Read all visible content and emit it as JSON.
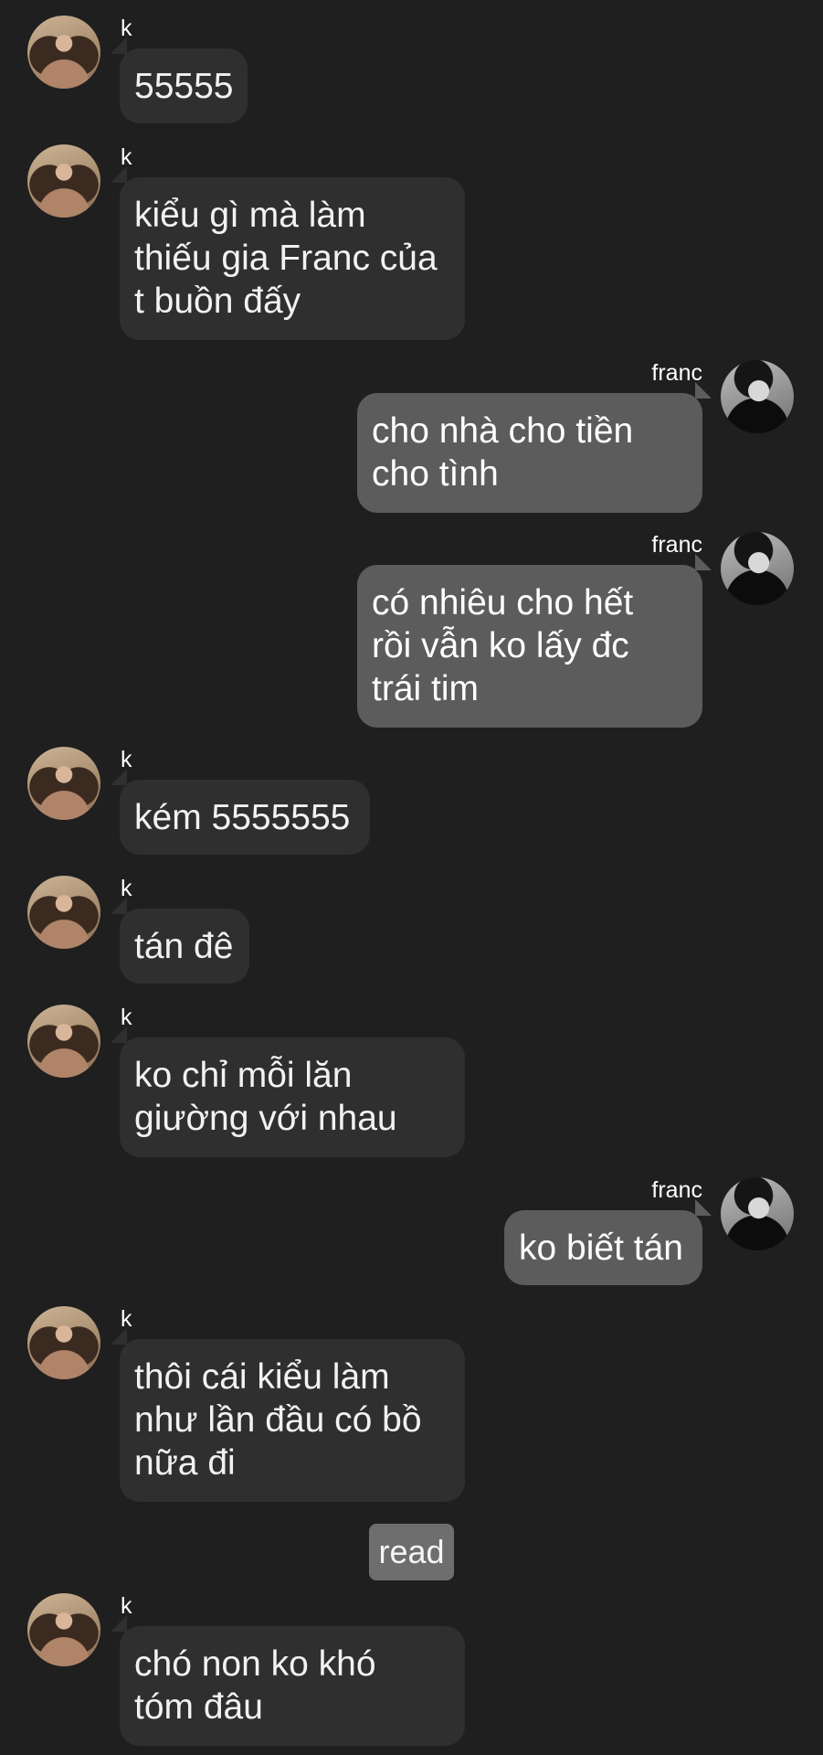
{
  "conversation": {
    "messages": [
      {
        "sender": "k",
        "side": "left",
        "avatar": "k-avatar",
        "lines": [
          "55555"
        ]
      },
      {
        "sender": "k",
        "side": "left",
        "avatar": "k-avatar",
        "lines": [
          "kiểu gì mà làm",
          "thiếu gia Franc của",
          "t buồn đấy"
        ]
      },
      {
        "sender": "franc",
        "side": "right",
        "avatar": "franc-avatar",
        "lines": [
          "cho nhà cho tiền",
          "cho tình"
        ]
      },
      {
        "sender": "franc",
        "side": "right",
        "avatar": "franc-avatar",
        "lines": [
          "có nhiêu cho hết",
          "rồi vẫn ko lấy đc",
          "trái tim"
        ]
      },
      {
        "sender": "k",
        "side": "left",
        "avatar": "k-avatar",
        "lines": [
          "kém 5555555"
        ]
      },
      {
        "sender": "k",
        "side": "left",
        "avatar": "k-avatar",
        "lines": [
          "tán đê"
        ]
      },
      {
        "sender": "k",
        "side": "left",
        "avatar": "k-avatar",
        "lines": [
          "ko chỉ mỗi lăn",
          "giường với nhau"
        ]
      },
      {
        "sender": "franc",
        "side": "right",
        "avatar": "franc-avatar",
        "lines": [
          "ko biết tán"
        ]
      },
      {
        "sender": "k",
        "side": "left",
        "avatar": "k-avatar",
        "lines": [
          "thôi cái kiểu làm",
          "như lần đầu có bồ",
          "nữa đi"
        ]
      },
      {
        "sender": "k",
        "side": "left",
        "avatar": "k-avatar",
        "lines": [
          "chó non ko khó",
          "tóm đâu"
        ]
      }
    ],
    "read_receipt": "read"
  },
  "colors": {
    "background": "#1f1f1f",
    "incoming_bubble": "#2f2f2f",
    "outgoing_bubble": "#5c5c5c",
    "read_badge": "#6e6e6e"
  }
}
